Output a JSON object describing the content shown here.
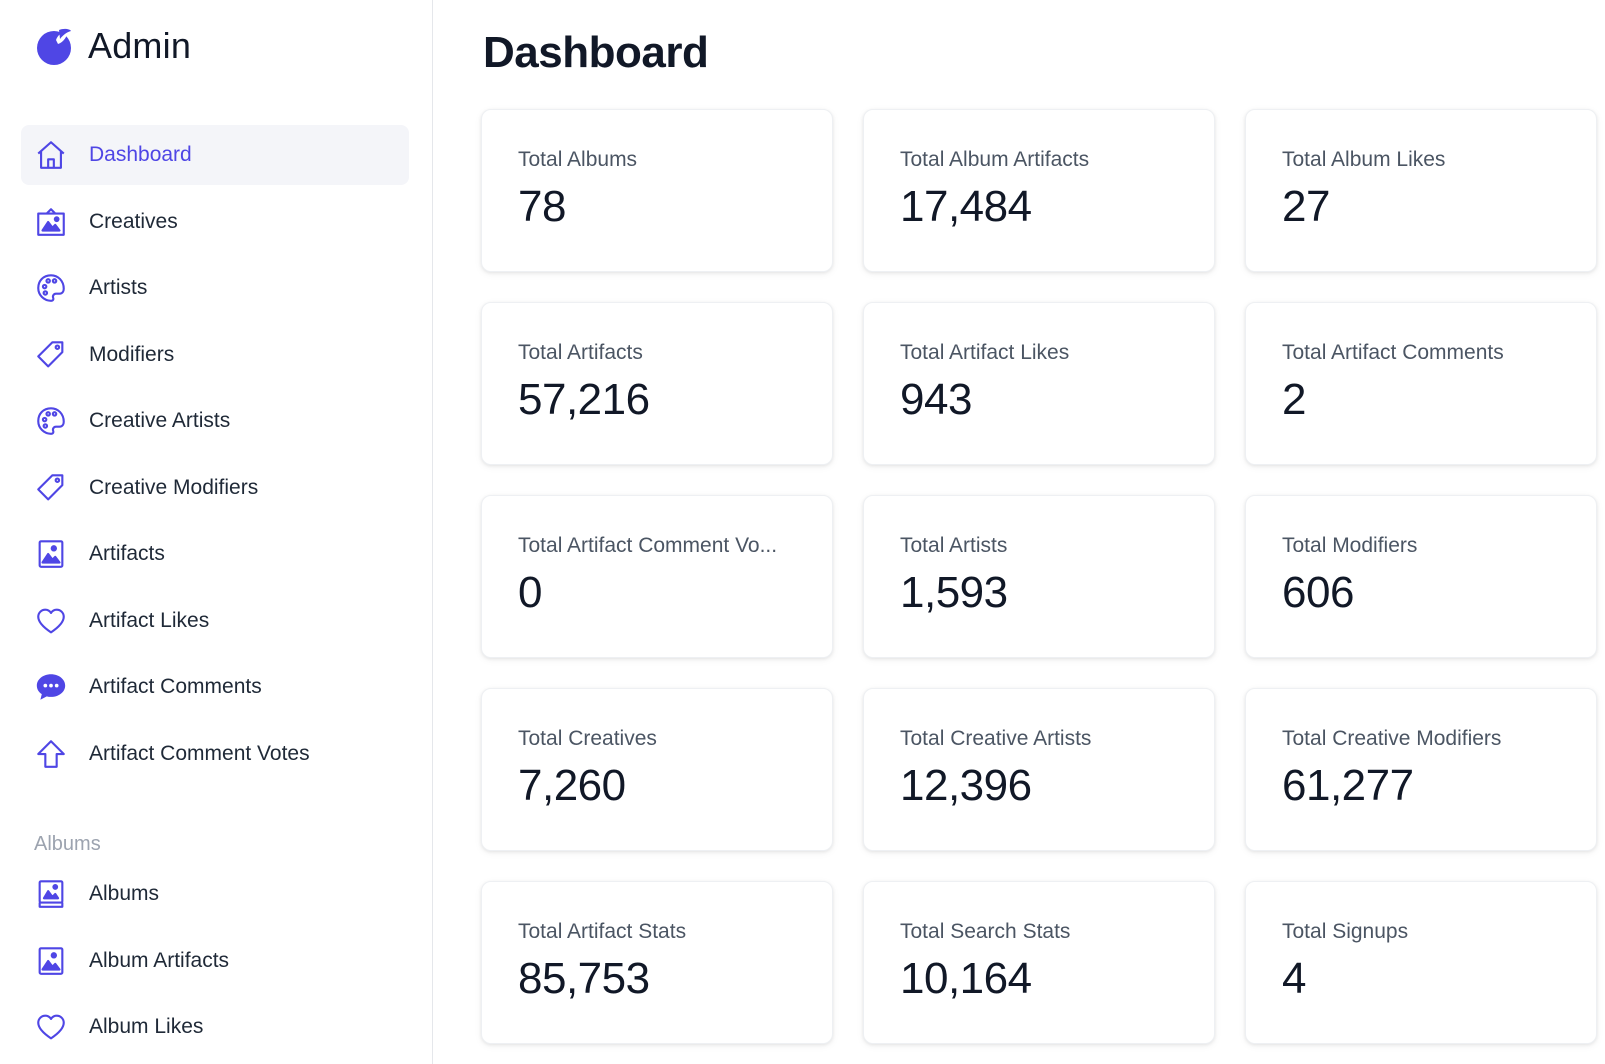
{
  "app": {
    "title": "Admin",
    "accent": "#4f46e5"
  },
  "sidebar": {
    "items": [
      {
        "label": "Dashboard",
        "icon": "home-icon",
        "active": true
      },
      {
        "label": "Creatives",
        "icon": "picture-frame-icon"
      },
      {
        "label": "Artists",
        "icon": "palette-icon"
      },
      {
        "label": "Modifiers",
        "icon": "tag-icon"
      },
      {
        "label": "Creative Artists",
        "icon": "palette-icon"
      },
      {
        "label": "Creative Modifiers",
        "icon": "tag-icon"
      },
      {
        "label": "Artifacts",
        "icon": "image-icon"
      },
      {
        "label": "Artifact Likes",
        "icon": "heart-icon"
      },
      {
        "label": "Artifact Comments",
        "icon": "chat-bubble-icon"
      },
      {
        "label": "Artifact Comment Votes",
        "icon": "arrow-up-icon"
      }
    ],
    "section": "Albums",
    "albums_items": [
      {
        "label": "Albums",
        "icon": "album-icon"
      },
      {
        "label": "Album Artifacts",
        "icon": "image-icon"
      },
      {
        "label": "Album Likes",
        "icon": "heart-icon"
      }
    ]
  },
  "main": {
    "title": "Dashboard",
    "cards": [
      {
        "label": "Total Albums",
        "value": "78"
      },
      {
        "label": "Total Album Artifacts",
        "value": "17,484"
      },
      {
        "label": "Total Album Likes",
        "value": "27"
      },
      {
        "label": "Total Artifacts",
        "value": "57,216"
      },
      {
        "label": "Total Artifact Likes",
        "value": "943"
      },
      {
        "label": "Total Artifact Comments",
        "value": "2"
      },
      {
        "label": "Total Artifact Comment Vo...",
        "value": "0"
      },
      {
        "label": "Total Artists",
        "value": "1,593"
      },
      {
        "label": "Total Modifiers",
        "value": "606"
      },
      {
        "label": "Total Creatives",
        "value": "7,260"
      },
      {
        "label": "Total Creative Artists",
        "value": "12,396"
      },
      {
        "label": "Total Creative Modifiers",
        "value": "61,277"
      },
      {
        "label": "Total Artifact Stats",
        "value": "85,753"
      },
      {
        "label": "Total Search Stats",
        "value": "10,164"
      },
      {
        "label": "Total Signups",
        "value": "4"
      }
    ]
  }
}
